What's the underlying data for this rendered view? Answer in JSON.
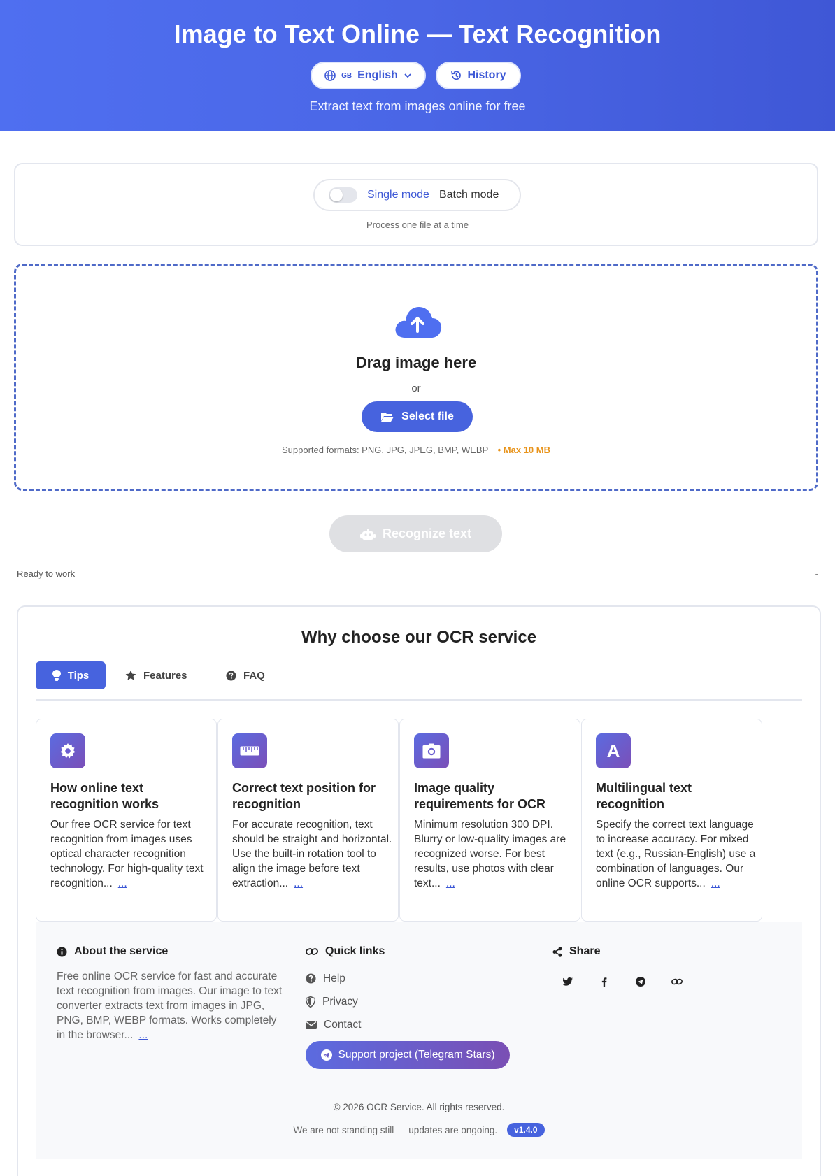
{
  "header": {
    "title": "Image to Text Online — Text Recognition",
    "lang_flag": "GB",
    "lang_label": "English",
    "history_label": "History",
    "subtitle": "Extract text from images online for free"
  },
  "mode": {
    "single_label": "Single mode",
    "batch_label": "Batch mode",
    "hint": "Process one file at a time"
  },
  "upload": {
    "drag_text": "Drag image here",
    "or_text": "or",
    "select_label": "Select file",
    "formats_text": "Supported formats: PNG, JPG, JPEG, BMP, WEBP",
    "max_size": "• Max 10 MB"
  },
  "actions": {
    "recognize_label": "Recognize text"
  },
  "status": {
    "left": "Ready to work",
    "right": "-"
  },
  "why": {
    "title": "Why choose our OCR service",
    "tabs": [
      {
        "label": "Tips"
      },
      {
        "label": "Features"
      },
      {
        "label": "FAQ"
      }
    ],
    "cards": [
      {
        "title": "How online text recognition works",
        "text": "Our free OCR service for text recognition from images uses optical character recognition technology. For high-quality text recognition...",
        "more": "..."
      },
      {
        "title": "Correct text position for recognition",
        "text": "For accurate recognition, text should be straight and horizontal. Use the built-in rotation tool to align the image before text extraction...",
        "more": "..."
      },
      {
        "title": "Image quality requirements for OCR",
        "text": "Minimum resolution 300 DPI. Blurry or low-quality images are recognized worse. For best results, use photos with clear text...",
        "more": "..."
      },
      {
        "title": "Multilingual text recognition",
        "text": "Specify the correct text language to increase accuracy. For mixed text (e.g., Russian-English) use a combination of languages. Our online OCR supports...",
        "more": "...",
        "icon_letter": "A"
      }
    ]
  },
  "footer": {
    "about_title": "About the service",
    "about_text": "Free online OCR service for fast and accurate text recognition from images. Our image to text converter extracts text from images in JPG, PNG, BMP, WEBP formats. Works completely in the browser...",
    "about_more": "...",
    "links_title": "Quick links",
    "links": [
      {
        "label": "Help",
        "icon": "question-circle-icon"
      },
      {
        "label": "Privacy",
        "icon": "shield-icon"
      },
      {
        "label": "Contact",
        "icon": "envelope-icon"
      }
    ],
    "support_label": "Support project (Telegram Stars)",
    "share_title": "Share",
    "share_icons": [
      "twitter-icon",
      "facebook-icon",
      "telegram-icon",
      "link-icon"
    ],
    "copyright": "© 2026 OCR Service. All rights reserved.",
    "ongoing": "We are not standing still — updates are ongoing.",
    "version": "v1.4.0"
  },
  "colors": {
    "accent": "#4763de",
    "warning": "#e8931a",
    "icon_gradient_start": "#5b6be0",
    "icon_gradient_end": "#7b4fb8"
  }
}
